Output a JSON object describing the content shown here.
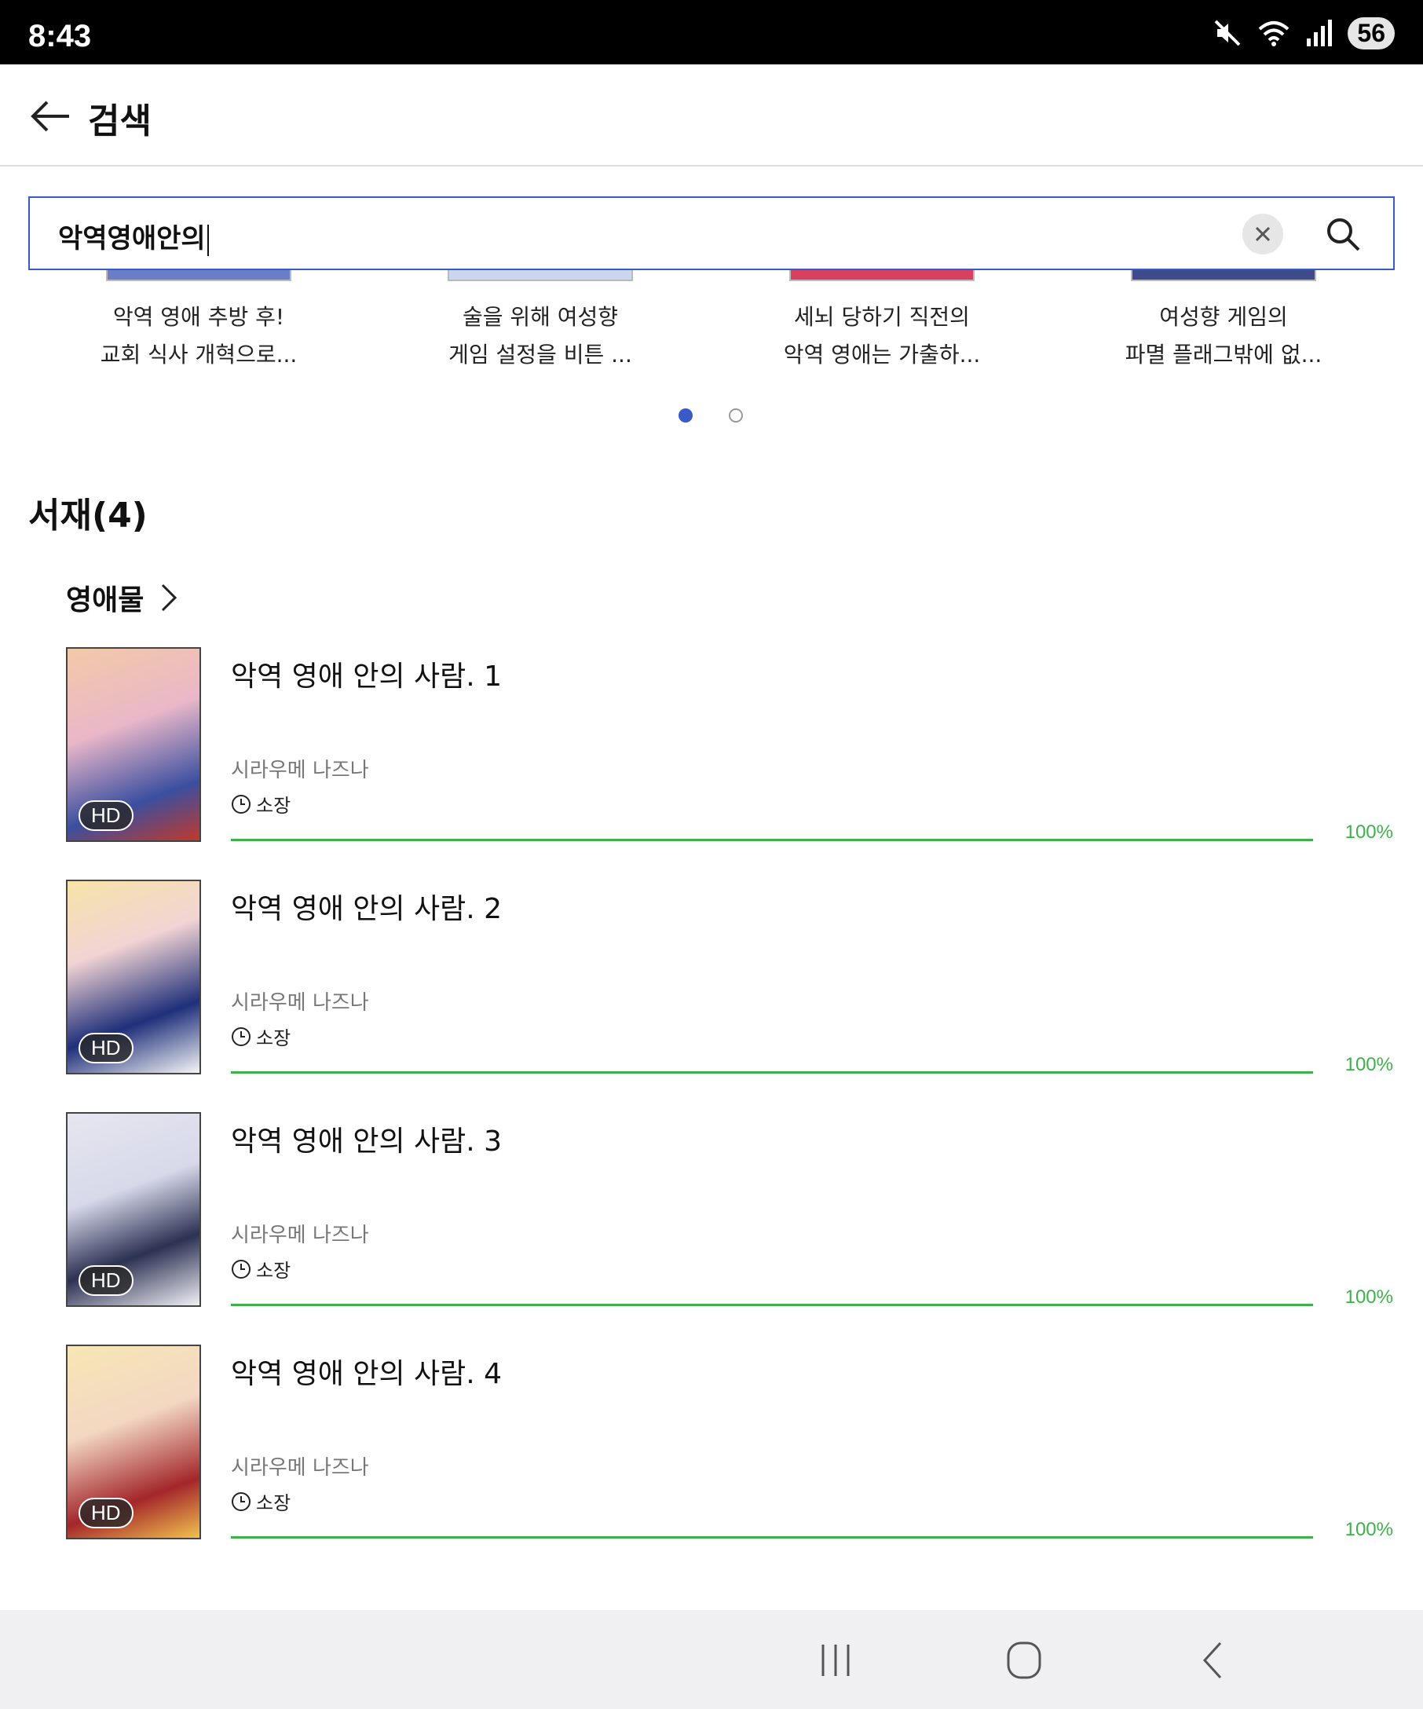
{
  "status_bar": {
    "time": "8:43",
    "battery": "56"
  },
  "header": {
    "title": "검색"
  },
  "search": {
    "value": "악역영애안의"
  },
  "carousel": {
    "items": [
      {
        "line1": "악역 영애 추방 후!",
        "line2": "교회 식사 개혁으로..."
      },
      {
        "line1": "술을 위해 여성향",
        "line2": "게임 설정을 비튼 ..."
      },
      {
        "line1": "세뇌 당하기 직전의",
        "line2": "악역 영애는 가출하..."
      },
      {
        "line1": "여성향 게임의",
        "line2": "파멸 플래그밖에 없..."
      }
    ],
    "page_count": 2,
    "active_page": 1
  },
  "library": {
    "title": "서재(4)",
    "category": "영애물",
    "books": [
      {
        "title": "악역 영애 안의 사람. 1",
        "author": "시라우메 나즈나",
        "status": "소장",
        "badge": "HD",
        "progress_pct": 100,
        "progress_label": "100%"
      },
      {
        "title": "악역 영애 안의 사람. 2",
        "author": "시라우메 나즈나",
        "status": "소장",
        "badge": "HD",
        "progress_pct": 100,
        "progress_label": "100%"
      },
      {
        "title": "악역 영애 안의 사람. 3",
        "author": "시라우메 나즈나",
        "status": "소장",
        "badge": "HD",
        "progress_pct": 100,
        "progress_label": "100%"
      },
      {
        "title": "악역 영애 안의 사람. 4",
        "author": "시라우메 나즈나",
        "status": "소장",
        "badge": "HD",
        "progress_pct": 100,
        "progress_label": "100%"
      }
    ]
  },
  "colors": {
    "accent": "#3a5bc7",
    "progress": "#3db14a"
  },
  "icons": {
    "back": "arrow-left-icon",
    "clear": "close-icon",
    "search": "search-icon",
    "chevron": "chevron-right-icon",
    "clock": "clock-icon",
    "nav_recents": "recent-apps-icon",
    "nav_home": "home-icon",
    "nav_back": "back-chevron-icon"
  }
}
